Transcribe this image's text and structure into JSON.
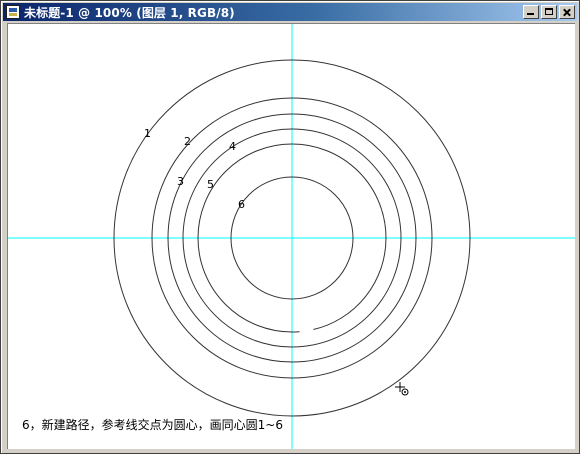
{
  "window": {
    "title": "未标题-1 @ 100% (图层 1, RGB/8)"
  },
  "controls": {
    "minimize": "minimize",
    "maximize": "maximize",
    "close": "close"
  },
  "colors": {
    "titlebar_start": "#0a246a",
    "guide": "#00ffff",
    "circle_stroke": "#000000"
  },
  "circles": {
    "labels": [
      "1",
      "2",
      "3",
      "4",
      "5",
      "6"
    ]
  },
  "canvas": {
    "caption": "6，新建路径，参考线交点为圆心，画同心圆1~6"
  },
  "icons": {
    "cursor": "crosshair-cursor-icon"
  }
}
